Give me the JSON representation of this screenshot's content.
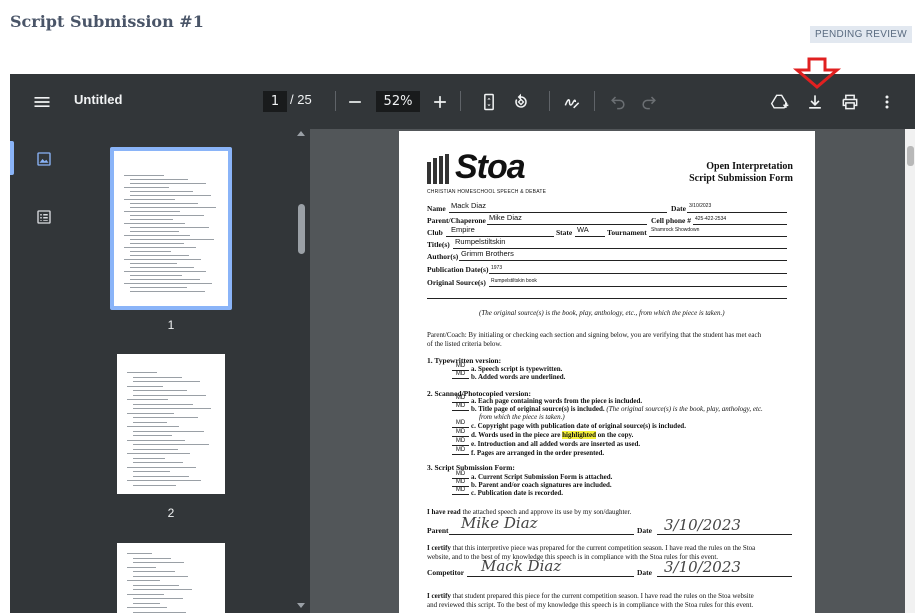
{
  "page": {
    "title": "Script Submission #1",
    "status": "PENDING REVIEW"
  },
  "toolbar": {
    "menu_icon": "menu-icon",
    "doc_title": "Untitled",
    "page_current": "1",
    "page_total": "/ 25",
    "zoom": "52%",
    "icons": [
      "zoom-out-icon",
      "zoom-in-icon",
      "fit-page-icon",
      "rotate-icon",
      "annotate-icon",
      "undo-icon",
      "redo-icon",
      "save-to-drive-icon",
      "download-icon",
      "print-icon",
      "more-vert-icon"
    ]
  },
  "sidebar": {
    "tabs": [
      "thumbnails-icon",
      "outline-icon"
    ],
    "thumbnails": [
      {
        "number": "1",
        "selected": true
      },
      {
        "number": "2",
        "selected": false
      }
    ]
  },
  "document": {
    "logo": "Stoa",
    "logo_subtitle": "CHRISTIAN HOMESCHOOL SPEECH & DEBATE",
    "form_title_1": "Open Interpretation",
    "form_title_2": "Script Submission Form",
    "fields": {
      "name_label": "Name",
      "name": "Mack Diaz",
      "date_label": "Date",
      "date": "3/10/2023",
      "parent_label": "Parent/Chaperone",
      "parent": "Mike Diaz",
      "cell_label": "Cell phone #",
      "cell": "425-422-2534",
      "club_label": "Club",
      "club": "Empire",
      "state_label": "State",
      "state": "WA",
      "tournament_label": "Tournament",
      "tournament": "Shamrock Showdown",
      "titles_label": "Title(s)",
      "titles": "Rumpelstiltskin",
      "authors_label": "Author(s)",
      "authors": "Grimm Brothers",
      "pubdate_label": "Publication Date(s)",
      "pubdate": "1973",
      "source_label": "Original Source(s)",
      "source": "Rumpelstiltskin book"
    },
    "source_note": "(The original source(s) is the book, play, anthology, etc., from which the piece is taken.)",
    "intro_1": "Parent/Coach: By initialing or checking each section and signing below, you are verifying that the student has met each",
    "intro_2": "of the listed criteria below.",
    "sec1": "1. Typewritten version:",
    "sec1_items": [
      "a. Speech script is typewritten.",
      "b. Added words are underlined."
    ],
    "sec2": "2. Scanned/Photocopied version:",
    "sec2_a": "a. Each page containing words from the piece is included.",
    "sec2_b": "b. Title page of original source(s) is included.",
    "sec2_b_note": "(The original source(s) is the book, play, anthology, etc.",
    "sec2_b_note2": "from which the piece is taken.)",
    "sec2_c": "c. Copyright page with publication date of original source(s) is included.",
    "sec2_d_pre": "d. Words used in the piece are",
    "sec2_d_hl": "highlighted",
    "sec2_d_post": "on the copy.",
    "sec2_e": "e. Introduction and all added words are inserted as used.",
    "sec2_f": "f. Pages are arranged in the order presented.",
    "sec3": "3. Script Submission Form:",
    "sec3_items": [
      "a. Current Script Submission Form is attached.",
      "b. Parent and/or coach signatures are included.",
      "c. Publication date is recorded."
    ],
    "initials": "MD",
    "read_pre": "I have read",
    "read_post": "the attached speech and approve its use by my son/daughter.",
    "parent_sig_label": "Parent",
    "parent_sig": "Mike Diaz",
    "date_sig_label": "Date",
    "date_sig": "3/10/2023",
    "certify_1a": "I certify",
    "certify_1b": "that this interpretive piece was prepared for the current competition season. I have read the rules on the Stoa",
    "certify_1c": "website, and to the best of my knowledge this speech is in compliance with the Stoa rules for this event.",
    "competitor_label": "Competitor",
    "competitor_sig": "Mack Diaz",
    "certify_2a": "I certify",
    "certify_2b": "that student prepared this piece for the current competition season. I have read the rules on the Stoa website",
    "certify_2c": "and reviewed this script. To the best of my knowledge this speech is in compliance with the Stoa rules for this event."
  },
  "colors": {
    "annotation_arrow": "#e02020",
    "toolbar_bg": "#323639",
    "viewer_bg": "#525659",
    "accent": "#8ab4f8",
    "highlight": "#f4f13a"
  }
}
